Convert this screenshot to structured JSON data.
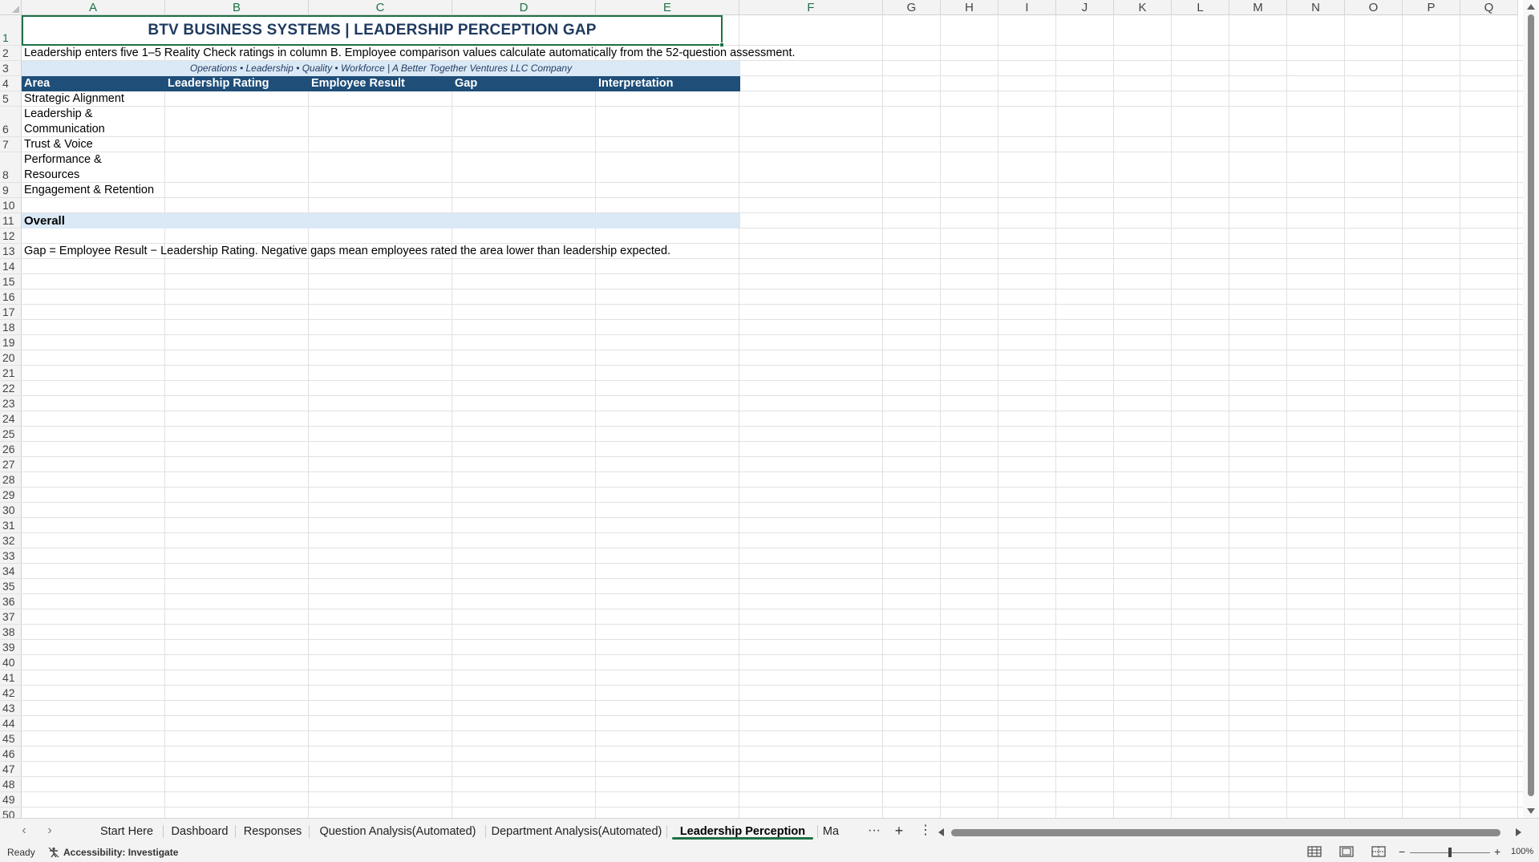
{
  "columns": [
    "A",
    "B",
    "C",
    "D",
    "E",
    "F",
    "G",
    "H",
    "I",
    "J",
    "K",
    "L",
    "M",
    "N",
    "O",
    "P",
    "Q"
  ],
  "selected_columns": [
    "A",
    "B",
    "C",
    "D",
    "E",
    "F"
  ],
  "rows_visible": [
    "1",
    "2",
    "3",
    "4",
    "5",
    "6",
    "7",
    "8",
    "9",
    "10",
    "11",
    "12",
    "13",
    "14",
    "15",
    "16",
    "17",
    "18",
    "19",
    "20",
    "21",
    "22",
    "23",
    "24",
    "25",
    "26",
    "27",
    "28",
    "29",
    "30",
    "31",
    "32",
    "33",
    "34",
    "35",
    "36",
    "37",
    "38",
    "39",
    "40",
    "41",
    "42",
    "43",
    "44",
    "45",
    "46",
    "47",
    "48",
    "49",
    "50"
  ],
  "sheet": {
    "title": "BTV BUSINESS SYSTEMS | LEADERSHIP PERCEPTION GAP",
    "instructions": "Leadership enters five 1–5 Reality Check ratings in column B. Employee comparison values calculate automatically from the 52-question assessment.",
    "subtitle": "Operations • Leadership • Quality • Workforce | A Better Together Ventures LLC Company",
    "headers": [
      "Area",
      "Leadership Rating",
      "Employee Result",
      "Gap",
      "Interpretation"
    ],
    "areas": [
      "Strategic Alignment",
      "Leadership & Communication",
      "Trust & Voice",
      "Performance & Resources",
      "Engagement & Retention"
    ],
    "overall_label": "Overall",
    "note": "Gap = Employee Result − Leadership Rating. Negative gaps mean employees rated the area lower than leadership expected."
  },
  "tabs": {
    "items": [
      "Start Here",
      "Dashboard",
      "Responses",
      "Question Analysis(Automated)",
      "Department Analysis(Automated)",
      "Leadership Perception Gap",
      "Ma"
    ],
    "active": "Leadership Perception Gap",
    "more": "···",
    "add": "+",
    "options": "⋮"
  },
  "status": {
    "ready": "Ready",
    "accessibility": "Accessibility: Investigate",
    "zoom": "100%",
    "zoom_minus": "−",
    "zoom_plus": "+"
  },
  "colors": {
    "header_fill": "#1f4e79",
    "light_fill": "#dbe9f6",
    "title_text": "#1f3a5f",
    "selection": "#1e7145"
  }
}
